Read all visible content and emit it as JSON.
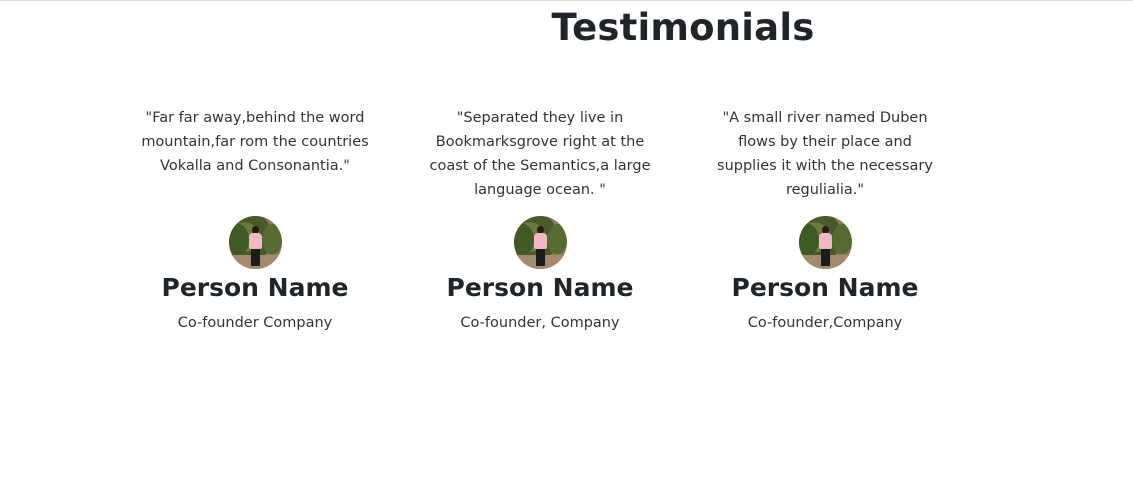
{
  "section": {
    "title": "Testimonials"
  },
  "testimonials": [
    {
      "quote": "\"Far far away,behind the word mountain,far rom the countries Vokalla and Consonantia.\"",
      "name": "Person Name",
      "role": "Co-founder Company",
      "avatar_icon": "person-photo"
    },
    {
      "quote": "\"Separated they live in Bookmarksgrove right at the coast of the Semantics,a large language ocean. \"",
      "name": "Person Name",
      "role": "Co-founder, Company",
      "avatar_icon": "person-photo"
    },
    {
      "quote": "\"A small river named Duben flows by their place and supplies it with the necessary regulialia.\"",
      "name": "Person Name",
      "role": "Co-founder,Company",
      "avatar_icon": "person-photo"
    }
  ]
}
